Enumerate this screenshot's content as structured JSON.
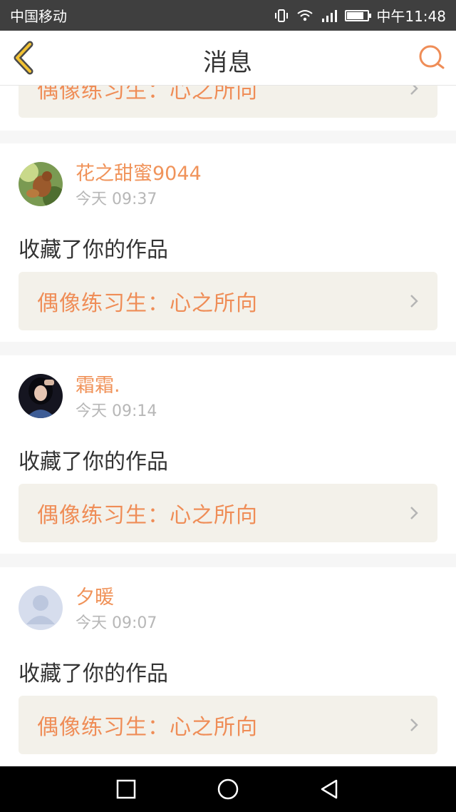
{
  "status_bar": {
    "carrier": "中国移动",
    "time": "中午11:48",
    "icons": [
      "vibrate-icon",
      "wifi-icon",
      "signal-icon",
      "battery-icon"
    ],
    "battery_level_fraction": 0.8
  },
  "header": {
    "title": "消息",
    "back_icon": "chevron-left-icon",
    "search_icon": "search-icon"
  },
  "previous_item": {
    "work_title": "偶像练习生：心之所向"
  },
  "messages": [
    {
      "username": "花之甜蜜9044",
      "time": "今天 09:37",
      "action": "收藏了你的作品",
      "work_title": "偶像练习生：心之所向",
      "avatar": "avatar-photo-squirrel"
    },
    {
      "username": "霜霜.",
      "time": "今天 09:14",
      "action": "收藏了你的作品",
      "work_title": "偶像练习生：心之所向",
      "avatar": "avatar-photo-girl"
    },
    {
      "username": "夕暖",
      "time": "今天 09:07",
      "action": "收藏了你的作品",
      "work_title": "偶像练习生：心之所向",
      "avatar": "avatar-default-silhouette"
    }
  ],
  "system_nav": {
    "recent_icon": "square-icon",
    "home_icon": "circle-icon",
    "back_icon": "triangle-back-icon"
  },
  "colors": {
    "accent": "#ef8d57",
    "link_background": "#f3f1ea"
  }
}
